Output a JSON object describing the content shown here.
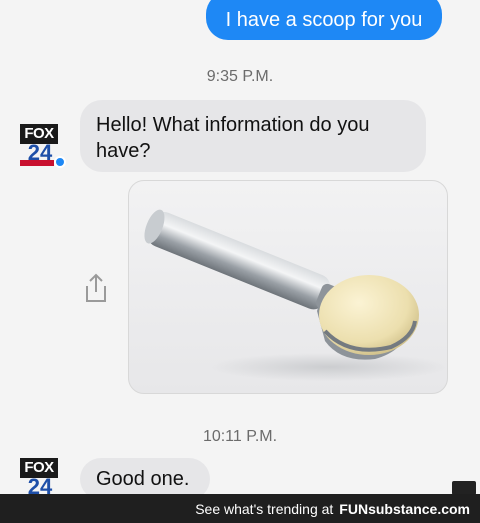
{
  "messages": {
    "outgoing_1": "I have a scoop for you",
    "timestamp_1": "9:35 P.M.",
    "incoming_1": "Hello! What information do you have?",
    "timestamp_2": "10:11 P.M.",
    "incoming_2": "Good one."
  },
  "avatar": {
    "brand": "FOX",
    "number": "24"
  },
  "footer": {
    "text": "See what's trending at",
    "brand": "FUNsubstance.com"
  },
  "icons": {
    "share": "share-icon",
    "image": "ice-cream-scoop-image"
  },
  "colors": {
    "outgoing_bubble": "#1e88f5",
    "incoming_bubble": "#e6e6e8",
    "footer_bg": "#1f1f1f"
  }
}
